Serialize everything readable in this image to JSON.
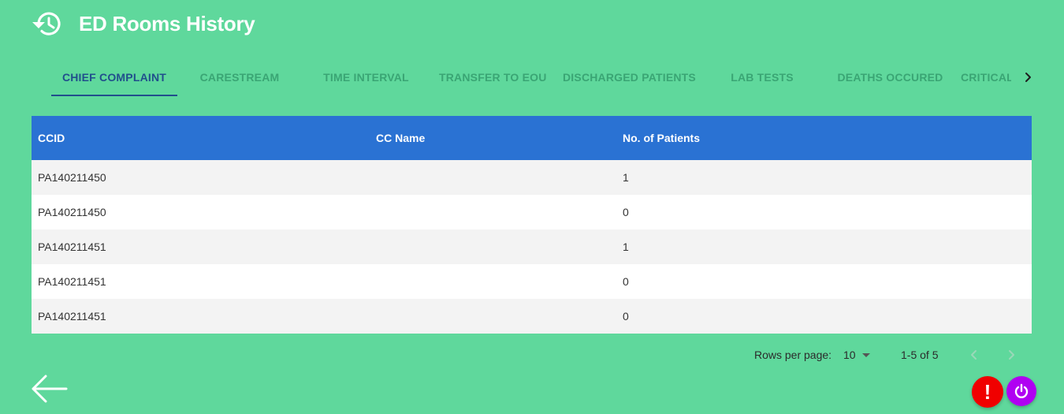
{
  "app": {
    "title": "ED Rooms History",
    "icon": "history-icon"
  },
  "tabs": [
    {
      "label": "CHIEF COMPLAINT",
      "active": true
    },
    {
      "label": "CARESTREAM",
      "active": false
    },
    {
      "label": "TIME INTERVAL",
      "active": false
    },
    {
      "label": "TRANSFER TO EOU",
      "active": false
    },
    {
      "label": "DISCHARGED PATIENTS",
      "active": false
    },
    {
      "label": "LAB TESTS",
      "active": false
    },
    {
      "label": "DEATHS OCCURED",
      "active": false
    },
    {
      "label": "CRITICAL",
      "active": false
    }
  ],
  "table": {
    "columns": [
      "CCID",
      "CC Name",
      "No. of Patients"
    ],
    "rows": [
      [
        "PA140211450",
        "",
        "1"
      ],
      [
        "PA140211450",
        "",
        "0"
      ],
      [
        "PA140211451",
        "",
        "1"
      ],
      [
        "PA140211451",
        "",
        "0"
      ],
      [
        "PA140211451",
        "",
        "0"
      ]
    ]
  },
  "pagination": {
    "rows_per_page_label": "Rows per page:",
    "rows_per_page_value": "10",
    "range_label": "1-5 of 5"
  },
  "colors": {
    "background": "#5fd89c",
    "table_header": "#2a72d3",
    "active_tab": "#214f8c",
    "inactive_tab": "#3aa574",
    "alert_button": "#f00000",
    "power_button": "#b000f2"
  },
  "icons": [
    "history-icon",
    "chevron-right-icon",
    "chevron-left-icon",
    "back-arrow-icon",
    "exclamation-icon",
    "power-icon"
  ]
}
